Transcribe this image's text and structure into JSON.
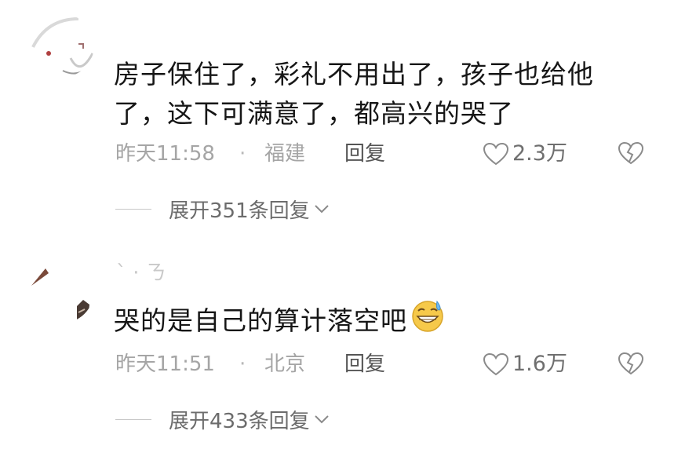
{
  "comments": [
    {
      "username": "",
      "content_line1": "房子保住了，彩礼不用出了，孩子也给他",
      "content_line2": "了，这下可满意了，都高兴的哭了",
      "time": "昨天11:58",
      "separator": "·",
      "location": "福建",
      "reply_label": "回复",
      "likes": "2.3万",
      "like_icon": "heart-outline-icon",
      "dislike_icon": "broken-heart-icon",
      "expand_label": "展开351条回复"
    },
    {
      "username": "` ·     ㄋ",
      "content": "哭的是自己的算计落空吧",
      "emoji": "grinning-sweat-emoji",
      "time": "昨天11:51",
      "separator": "·",
      "location": "北京",
      "reply_label": "回复",
      "likes": "1.6万",
      "like_icon": "heart-outline-icon",
      "dislike_icon": "broken-heart-icon",
      "expand_label": "展开433条回复"
    }
  ],
  "colors": {
    "text_primary": "#161616",
    "text_secondary": "#a5a5a5",
    "reply_text": "#555555",
    "emoji_yellow": "#f6c94a",
    "sweat_blue": "#6fb8f0"
  }
}
